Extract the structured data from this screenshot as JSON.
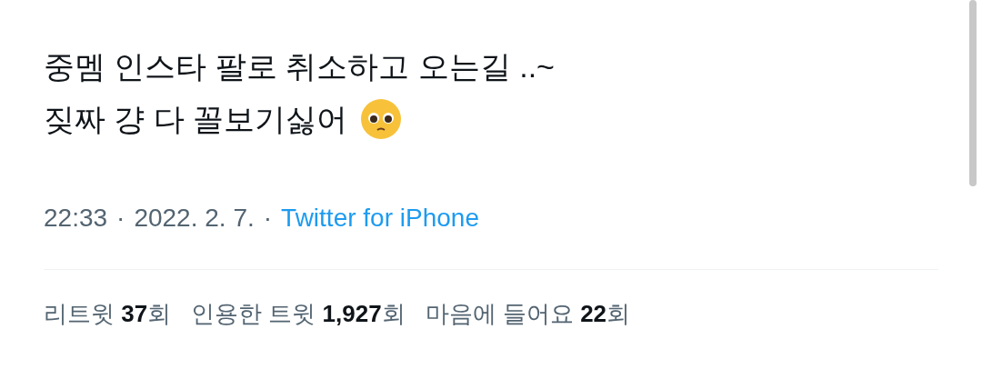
{
  "tweet": {
    "lines": [
      "중멤 인스타 팔로 취소하고 오는길 ..~",
      "짖짜 걍 다 꼴보기싫어"
    ],
    "meta": {
      "time": "22:33",
      "separator": "·",
      "date": "2022. 2. 7.",
      "separator_2": "·",
      "source": "Twitter for iPhone"
    },
    "stats": [
      "리트윗 **37**회",
      "인용한 트윗 **1,927**회",
      "마음에 들어요 **22**회"
    ]
  }
}
